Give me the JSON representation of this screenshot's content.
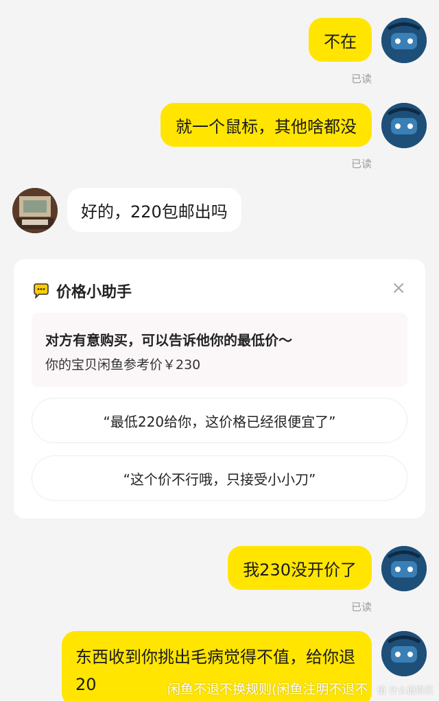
{
  "messages": [
    {
      "text": "不在",
      "read": "已读"
    },
    {
      "text": "就一个鼠标，其他啥都没",
      "read": "已读"
    },
    {
      "text": "好的，220包邮出吗"
    },
    {
      "text": "我230没开价了",
      "read": "已读"
    },
    {
      "text": "东西收到你挑出毛病觉得不值，给你退20"
    }
  ],
  "assistant": {
    "title": "价格小助手",
    "close": "×",
    "tip_line1": "对方有意购买，可以告诉他你的最低价～",
    "tip_line2": "你的宝贝闲鱼参考价￥230",
    "options": [
      "“最低220给你，这价格已经很便宜了”",
      "“这个价不行哦，只接受小小刀”"
    ]
  },
  "watermark": "闲鱼不退不换规则(闲鱼注明不退不",
  "watermark_logo": "值 什么值得买",
  "colors": {
    "bubble_self": "#ffe500",
    "bubble_other": "#ffffff",
    "background": "#f4f4f4"
  }
}
